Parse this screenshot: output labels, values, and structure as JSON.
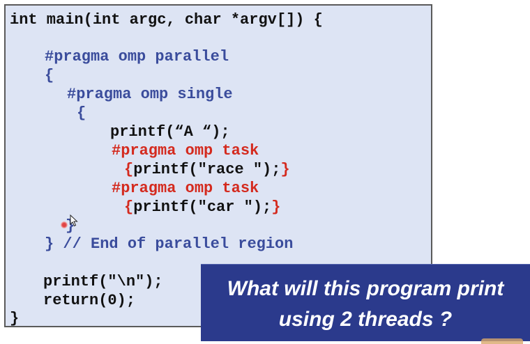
{
  "code": {
    "lines": [
      "int main(int argc, char *argv[]) {",
      "#pragma omp parallel",
      "{",
      "#pragma omp single",
      "{",
      "printf(“A “);",
      "#pragma omp task",
      "{printf(\"race \");}",
      "#pragma omp task",
      "{printf(\"car \");}",
      "}",
      "} // End of parallel region",
      "printf(\"\\n\");",
      "return(0);",
      "}"
    ]
  },
  "callout": {
    "line1": "What will this program print",
    "line2": "using 2 threads ?"
  },
  "colors": {
    "panel_background": "#dde4f4",
    "code_black": "#111111",
    "code_blue": "#3a4c9c",
    "code_red": "#d42a1e",
    "callout_background": "#2b3a8c",
    "callout_text": "#ffffff"
  },
  "icons": {
    "cursor": "mouse-pointer-icon",
    "click_marker": "click-indicator-icon"
  }
}
